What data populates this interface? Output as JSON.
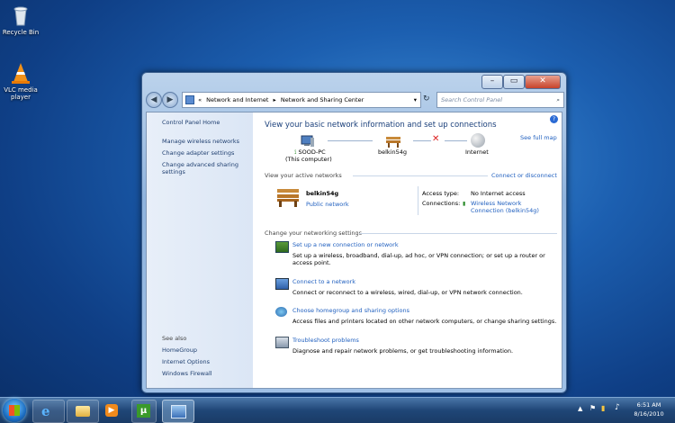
{
  "desktop": {
    "icons": [
      {
        "label": "Recycle Bin"
      },
      {
        "label": "VLC media player"
      }
    ]
  },
  "window": {
    "address": {
      "parts": [
        "«",
        "Network and Internet",
        "▸",
        "Network and Sharing Center"
      ]
    },
    "search_placeholder": "Search Control Panel",
    "sidebar": {
      "home": "Control Panel Home",
      "links": [
        "Manage wireless networks",
        "Change adapter settings",
        "Change advanced sharing settings"
      ],
      "see_also_title": "See also",
      "see_also": [
        "HomeGroup",
        "Internet Options",
        "Windows Firewall"
      ]
    },
    "main": {
      "title": "View your basic network information and set up connections",
      "see_full_map": "See full map",
      "map": {
        "computer_name": "SOOD-PC",
        "computer_sub": "(This computer)",
        "router": "belkin54g",
        "internet": "Internet"
      },
      "active_title": "View your active networks",
      "connect_disconnect": "Connect or disconnect",
      "network_name": "belkin54g",
      "network_type": "Public network",
      "access_type_label": "Access type:",
      "access_type_value": "No Internet access",
      "connections_label": "Connections:",
      "connection_value": "Wireless Network Connection (belkin54g)",
      "change_title": "Change your networking settings",
      "tasks": [
        {
          "title": "Set up a new connection or network",
          "desc": "Set up a wireless, broadband, dial-up, ad hoc, or VPN connection; or set up a router or access point."
        },
        {
          "title": "Connect to a network",
          "desc": "Connect or reconnect to a wireless, wired, dial-up, or VPN network connection."
        },
        {
          "title": "Choose homegroup and sharing options",
          "desc": "Access files and printers located on other network computers, or change sharing settings."
        },
        {
          "title": "Troubleshoot problems",
          "desc": "Diagnose and repair network problems, or get troubleshooting information."
        }
      ]
    }
  },
  "taskbar": {
    "time": "6:51 AM",
    "date": "8/16/2010"
  }
}
